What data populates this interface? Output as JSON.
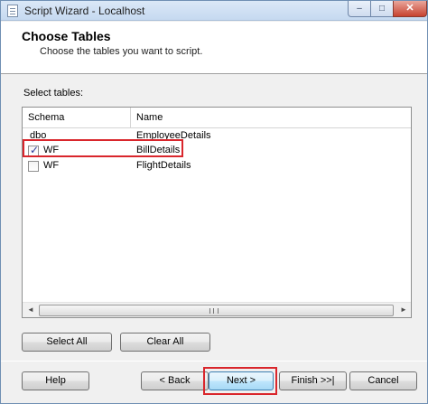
{
  "window": {
    "title": "Script Wizard - Localhost",
    "controls": {
      "minimize": "–",
      "maximize": "□",
      "close": "✕"
    }
  },
  "header": {
    "title": "Choose Tables",
    "subtitle": "Choose the tables you want to script."
  },
  "tables": {
    "label": "Select tables:",
    "columns": {
      "schema": "Schema",
      "name": "Name"
    },
    "rows": [
      {
        "schema": "dbo",
        "name": "EmployeeDetails",
        "has_checkbox": false,
        "checked": false
      },
      {
        "schema": "WF",
        "name": "BillDetails",
        "has_checkbox": true,
        "checked": true
      },
      {
        "schema": "WF",
        "name": "FlightDetails",
        "has_checkbox": true,
        "checked": false
      }
    ],
    "scroll_left_glyph": "◄",
    "scroll_right_glyph": "►"
  },
  "buttons": {
    "select_all": "Select All",
    "clear_all": "Clear All",
    "help": "Help",
    "back": "< Back",
    "next": "Next >",
    "finish": "Finish >>|",
    "cancel": "Cancel"
  },
  "colors": {
    "highlight": "#d9262c",
    "title_bar": "#c6d9f0",
    "dialog_bg": "#f0f0f0"
  }
}
